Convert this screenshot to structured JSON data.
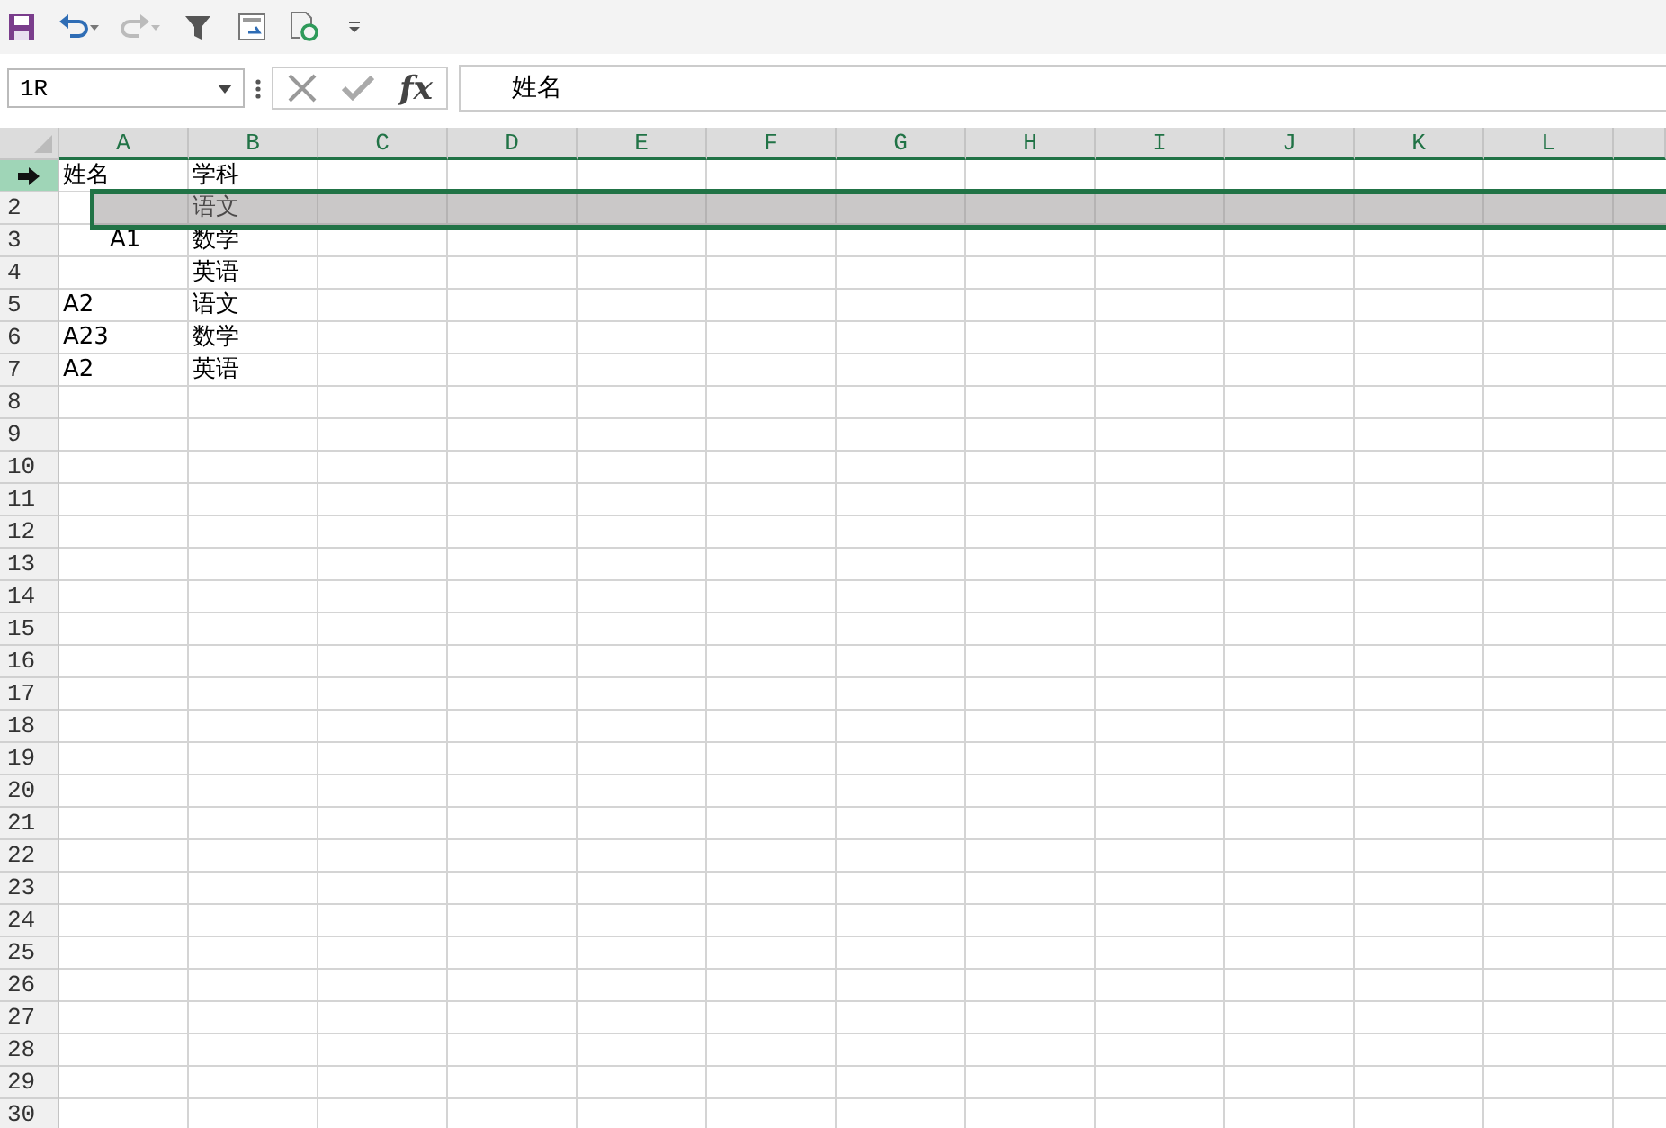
{
  "name_box": {
    "value": "1R"
  },
  "formula_bar": {
    "function_label": "fx",
    "value": "姓名"
  },
  "columns": [
    "A",
    "B",
    "C",
    "D",
    "E",
    "F",
    "G",
    "H",
    "I",
    "J",
    "K",
    "L"
  ],
  "rows": [
    {
      "selected": true,
      "dragging": false,
      "cells": [
        "姓名",
        "学科"
      ]
    },
    {
      "label": "2",
      "selected": false,
      "dragging": true,
      "cells": [
        "",
        "语文"
      ]
    },
    {
      "label": "3",
      "selected": false,
      "dragging": false,
      "cells": [
        "A1",
        "数学"
      ]
    },
    {
      "label": "4",
      "selected": false,
      "dragging": false,
      "cells": [
        "",
        "英语"
      ]
    },
    {
      "label": "5",
      "selected": false,
      "dragging": false,
      "cells": [
        "A2",
        "语文"
      ]
    },
    {
      "label": "6",
      "selected": false,
      "dragging": false,
      "cells": [
        "A23",
        "数学"
      ]
    },
    {
      "label": "7",
      "selected": false,
      "dragging": false,
      "cells": [
        "A2",
        "英语"
      ]
    },
    {
      "label": "8",
      "selected": false,
      "dragging": false,
      "cells": []
    },
    {
      "label": "9",
      "selected": false,
      "dragging": false,
      "cells": []
    },
    {
      "label": "10",
      "selected": false,
      "dragging": false,
      "cells": []
    },
    {
      "label": "11",
      "selected": false,
      "dragging": false,
      "cells": []
    },
    {
      "label": "12",
      "selected": false,
      "dragging": false,
      "cells": []
    },
    {
      "label": "13",
      "selected": false,
      "dragging": false,
      "cells": []
    },
    {
      "label": "14",
      "selected": false,
      "dragging": false,
      "cells": []
    },
    {
      "label": "15",
      "selected": false,
      "dragging": false,
      "cells": []
    },
    {
      "label": "16",
      "selected": false,
      "dragging": false,
      "cells": []
    },
    {
      "label": "17",
      "selected": false,
      "dragging": false,
      "cells": []
    },
    {
      "label": "18",
      "selected": false,
      "dragging": false,
      "cells": []
    },
    {
      "label": "19",
      "selected": false,
      "dragging": false,
      "cells": []
    },
    {
      "label": "20",
      "selected": false,
      "dragging": false,
      "cells": []
    },
    {
      "label": "21",
      "selected": false,
      "dragging": false,
      "cells": []
    },
    {
      "label": "22",
      "selected": false,
      "dragging": false,
      "cells": []
    },
    {
      "label": "23",
      "selected": false,
      "dragging": false,
      "cells": []
    },
    {
      "label": "24",
      "selected": false,
      "dragging": false,
      "cells": []
    },
    {
      "label": "25",
      "selected": false,
      "dragging": false,
      "cells": []
    },
    {
      "label": "26",
      "selected": false,
      "dragging": false,
      "cells": []
    },
    {
      "label": "27",
      "selected": false,
      "dragging": false,
      "cells": []
    },
    {
      "label": "28",
      "selected": false,
      "dragging": false,
      "cells": []
    },
    {
      "label": "29",
      "selected": false,
      "dragging": false,
      "cells": []
    },
    {
      "label": "30",
      "selected": false,
      "dragging": false,
      "cells": []
    }
  ]
}
